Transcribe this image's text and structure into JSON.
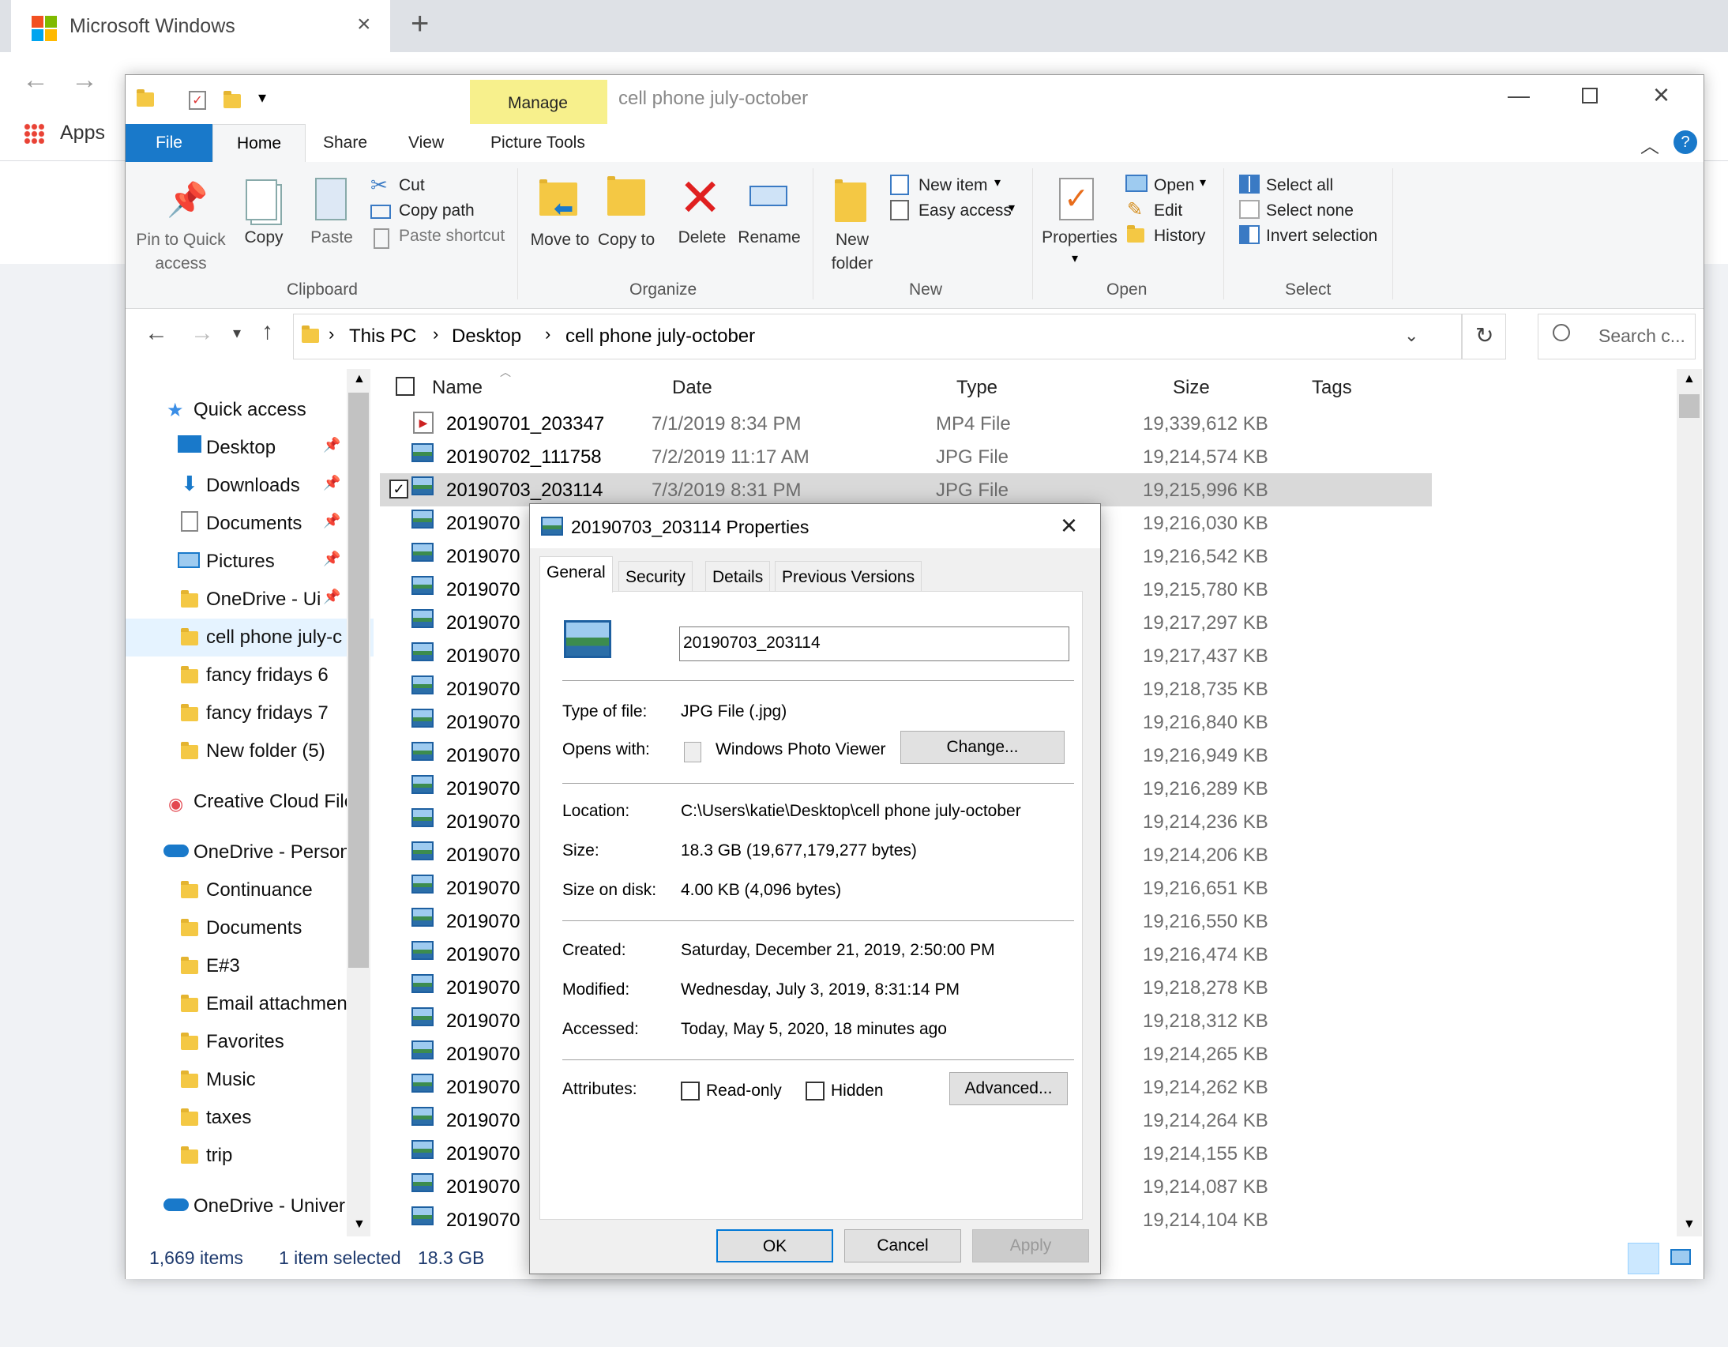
{
  "browser": {
    "tab_title": "Microsoft Windows",
    "bookmark_apps": "Apps"
  },
  "window": {
    "title": "cell phone july-october",
    "manage_label": "Manage",
    "menu_tabs": [
      "File",
      "Home",
      "Share",
      "View",
      "Picture Tools"
    ]
  },
  "ribbon": {
    "clipboard": {
      "pin": "Pin to Quick access",
      "copy": "Copy",
      "paste": "Paste",
      "cut": "Cut",
      "copy_path": "Copy path",
      "paste_shortcut": "Paste shortcut",
      "label": "Clipboard"
    },
    "organize": {
      "move_to": "Move to",
      "copy_to": "Copy to",
      "delete": "Delete",
      "rename": "Rename",
      "label": "Organize"
    },
    "new": {
      "new_folder": "New folder",
      "new_item": "New item",
      "easy_access": "Easy access",
      "label": "New"
    },
    "open": {
      "properties": "Properties",
      "open": "Open",
      "edit": "Edit",
      "history": "History",
      "label": "Open"
    },
    "select": {
      "select_all": "Select all",
      "select_none": "Select none",
      "invert": "Invert selection",
      "label": "Select"
    }
  },
  "address": {
    "crumbs": [
      "This PC",
      "Desktop",
      "cell phone july-october"
    ],
    "search_placeholder": "Search c..."
  },
  "nav": {
    "quick_access": "Quick access",
    "items": [
      "Desktop",
      "Downloads",
      "Documents",
      "Pictures",
      "OneDrive - Ui",
      "cell phone july-c",
      "fancy fridays 6",
      "fancy fridays 7",
      "New folder (5)"
    ],
    "creative_cloud": "Creative Cloud File",
    "onedrive_personal": "OneDrive - Person",
    "onedrive_items": [
      "Continuance",
      "Documents",
      "E#3",
      "Email attachmen",
      "Favorites",
      "Music",
      "taxes",
      "trip"
    ],
    "onedrive_univ": "OneDrive - Univer"
  },
  "columns": {
    "name": "Name",
    "date": "Date",
    "type": "Type",
    "size": "Size",
    "tags": "Tags"
  },
  "files": [
    {
      "name": "20190701_203347",
      "date": "7/1/2019 8:34 PM",
      "type": "MP4 File",
      "size": "19,339,612 KB"
    },
    {
      "name": "20190702_111758",
      "date": "7/2/2019 11:17 AM",
      "type": "JPG File",
      "size": "19,214,574 KB"
    },
    {
      "name": "20190703_203114",
      "date": "7/3/2019 8:31 PM",
      "type": "JPG File",
      "size": "19,215,996 KB"
    },
    {
      "name": "2019070",
      "size": "19,216,030 KB"
    },
    {
      "name": "2019070",
      "size": "19,216,542 KB"
    },
    {
      "name": "2019070",
      "size": "19,215,780 KB"
    },
    {
      "name": "2019070",
      "size": "19,217,297 KB"
    },
    {
      "name": "2019070",
      "size": "19,217,437 KB"
    },
    {
      "name": "2019070",
      "size": "19,218,735 KB"
    },
    {
      "name": "2019070",
      "size": "19,216,840 KB"
    },
    {
      "name": "2019070",
      "size": "19,216,949 KB"
    },
    {
      "name": "2019070",
      "size": "19,216,289 KB"
    },
    {
      "name": "2019070",
      "size": "19,214,236 KB"
    },
    {
      "name": "2019070",
      "size": "19,214,206 KB"
    },
    {
      "name": "2019070",
      "size": "19,216,651 KB"
    },
    {
      "name": "2019070",
      "size": "19,216,550 KB"
    },
    {
      "name": "2019070",
      "size": "19,216,474 KB"
    },
    {
      "name": "2019070",
      "size": "19,218,278 KB"
    },
    {
      "name": "2019070",
      "size": "19,218,312 KB"
    },
    {
      "name": "2019070",
      "size": "19,214,265 KB"
    },
    {
      "name": "2019070",
      "size": "19,214,262 KB"
    },
    {
      "name": "2019070",
      "size": "19,214,264 KB"
    },
    {
      "name": "2019070",
      "size": "19,214,155 KB"
    },
    {
      "name": "2019070",
      "size": "19,214,087 KB"
    },
    {
      "name": "2019070",
      "size": "19,214,104 KB"
    }
  ],
  "status": {
    "items": "1,669 items",
    "selected": "1 item selected",
    "size": "18.3 GB"
  },
  "dialog": {
    "title": "20190703_203114 Properties",
    "tabs": [
      "General",
      "Security",
      "Details",
      "Previous Versions"
    ],
    "filename": "20190703_203114",
    "type_label": "Type of file:",
    "type_value": "JPG File (.jpg)",
    "opens_label": "Opens with:",
    "opens_value": "Windows Photo Viewer",
    "change_btn": "Change...",
    "location_label": "Location:",
    "location_value": "C:\\Users\\katie\\Desktop\\cell phone july-october",
    "size_label": "Size:",
    "size_value": "18.3 GB (19,677,179,277 bytes)",
    "disk_label": "Size on disk:",
    "disk_value": "4.00 KB (4,096 bytes)",
    "created_label": "Created:",
    "created_value": "Saturday, December 21, 2019, 2:50:00 PM",
    "modified_label": "Modified:",
    "modified_value": "Wednesday, July 3, 2019, 8:31:14 PM",
    "accessed_label": "Accessed:",
    "accessed_value": "Today, May 5, 2020, 18 minutes ago",
    "attributes_label": "Attributes:",
    "readonly": "Read-only",
    "hidden": "Hidden",
    "advanced_btn": "Advanced...",
    "ok": "OK",
    "cancel": "Cancel",
    "apply": "Apply"
  }
}
